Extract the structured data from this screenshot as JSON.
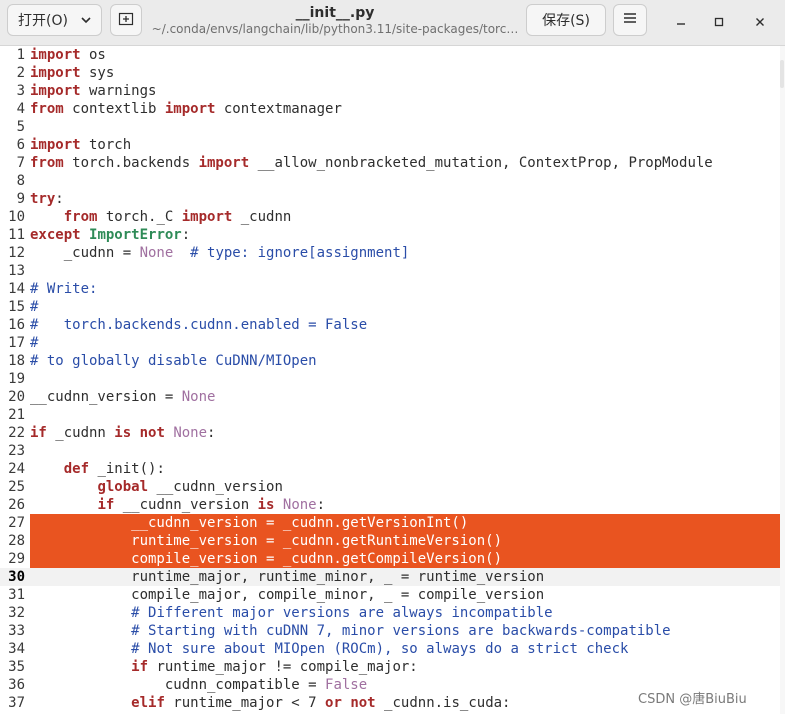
{
  "header": {
    "open_label": "打开(O)",
    "title": "__init__.py",
    "subtitle": "~/.conda/envs/langchain/lib/python3.11/site-packages/torc…",
    "save_label": "保存(S)",
    "icons": [
      "chevron-down-icon",
      "new-tab-icon",
      "hamburger-menu-icon",
      "minimize-icon",
      "maximize-icon",
      "close-icon"
    ]
  },
  "editor": {
    "current_line": 30,
    "selected_lines": [
      27,
      28,
      29
    ],
    "selection_color": "#e95420",
    "lines": [
      {
        "n": "1",
        "t": "import os"
      },
      {
        "n": "2",
        "t": "import sys"
      },
      {
        "n": "3",
        "t": "import warnings"
      },
      {
        "n": "4",
        "t": "from contextlib import contextmanager"
      },
      {
        "n": "5",
        "t": ""
      },
      {
        "n": "6",
        "t": "import torch"
      },
      {
        "n": "7",
        "t": "from torch.backends import __allow_nonbracketed_mutation, ContextProp, PropModule"
      },
      {
        "n": "8",
        "t": ""
      },
      {
        "n": "9",
        "t": "try:"
      },
      {
        "n": "10",
        "t": "    from torch._C import _cudnn"
      },
      {
        "n": "11",
        "t": "except ImportError:"
      },
      {
        "n": "12",
        "t": "    _cudnn = None  # type: ignore[assignment]"
      },
      {
        "n": "13",
        "t": ""
      },
      {
        "n": "14",
        "t": "# Write:"
      },
      {
        "n": "15",
        "t": "#"
      },
      {
        "n": "16",
        "t": "#   torch.backends.cudnn.enabled = False"
      },
      {
        "n": "17",
        "t": "#"
      },
      {
        "n": "18",
        "t": "# to globally disable CuDNN/MIOpen"
      },
      {
        "n": "19",
        "t": ""
      },
      {
        "n": "20",
        "t": "__cudnn_version = None"
      },
      {
        "n": "21",
        "t": ""
      },
      {
        "n": "22",
        "t": "if _cudnn is not None:"
      },
      {
        "n": "23",
        "t": ""
      },
      {
        "n": "24",
        "t": "    def _init():"
      },
      {
        "n": "25",
        "t": "        global __cudnn_version"
      },
      {
        "n": "26",
        "t": "        if __cudnn_version is None:"
      },
      {
        "n": "27",
        "t": "            __cudnn_version = _cudnn.getVersionInt()"
      },
      {
        "n": "28",
        "t": "            runtime_version = _cudnn.getRuntimeVersion()"
      },
      {
        "n": "29",
        "t": "            compile_version = _cudnn.getCompileVersion()"
      },
      {
        "n": "30",
        "t": "            runtime_major, runtime_minor, _ = runtime_version"
      },
      {
        "n": "31",
        "t": "            compile_major, compile_minor, _ = compile_version"
      },
      {
        "n": "32",
        "t": "            # Different major versions are always incompatible"
      },
      {
        "n": "33",
        "t": "            # Starting with cuDNN 7, minor versions are backwards-compatible"
      },
      {
        "n": "34",
        "t": "            # Not sure about MIOpen (ROCm), so always do a strict check"
      },
      {
        "n": "35",
        "t": "            if runtime_major != compile_major:"
      },
      {
        "n": "36",
        "t": "                cudnn_compatible = False"
      },
      {
        "n": "37",
        "t": "            elif runtime_major < 7 or not _cudnn.is_cuda:"
      }
    ]
  },
  "watermark": "CSDN @唐BiuBiu"
}
